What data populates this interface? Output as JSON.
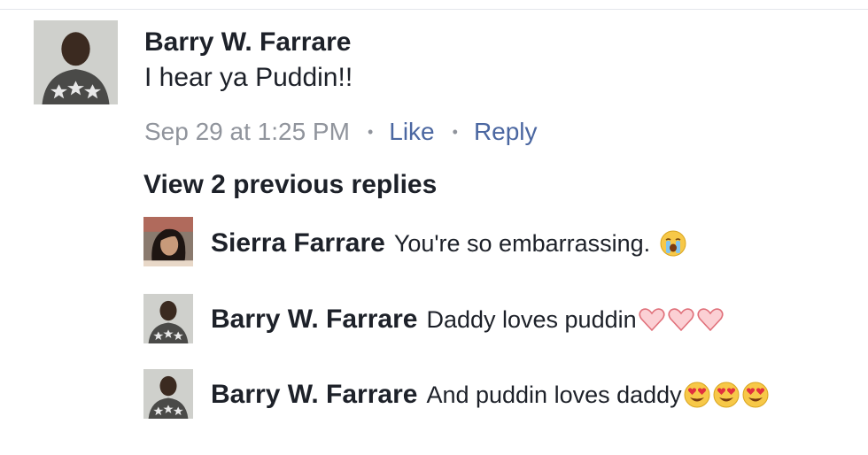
{
  "main_comment": {
    "author": "Barry W. Farrare",
    "text": "I hear ya Puddin!!",
    "timestamp": "Sep 29 at 1:25 PM",
    "like_label": "Like",
    "reply_label": "Reply",
    "separator": "•"
  },
  "view_previous_replies": "View 2 previous replies",
  "replies": [
    {
      "author": "Sierra Farrare",
      "text": "You're so embarrassing.",
      "emojis": [
        "crying-face"
      ]
    },
    {
      "author": "Barry W. Farrare",
      "text": "Daddy loves puddin",
      "emojis": [
        "pink-heart",
        "pink-heart",
        "pink-heart"
      ]
    },
    {
      "author": "Barry W. Farrare",
      "text": "And puddin loves daddy",
      "emojis": [
        "heart-eyes",
        "heart-eyes",
        "heart-eyes"
      ]
    }
  ],
  "colors": {
    "text": "#1d2129",
    "meta_gray": "#90949c",
    "link_blue": "#4b67a1",
    "divider": "#e4e6eb"
  }
}
